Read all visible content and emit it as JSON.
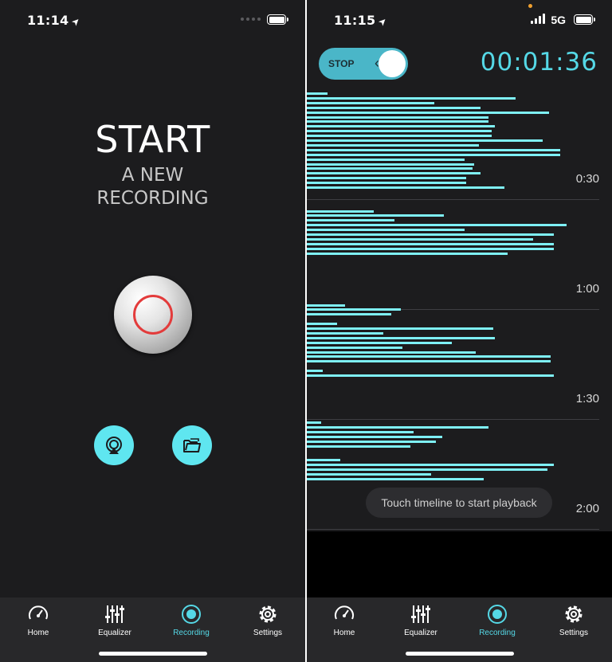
{
  "left_screen": {
    "status": {
      "time": "11:14"
    },
    "title": "START",
    "subtitle_line1": "A NEW",
    "subtitle_line2": "RECORDING",
    "icons": {
      "airplay": "airplay-icon",
      "folder": "folder-icon"
    }
  },
  "right_screen": {
    "status": {
      "time": "11:15",
      "network": "5G"
    },
    "toggle_label": "STOP",
    "timer": "00:01:36",
    "time_markers": [
      "0:30",
      "1:00",
      "1:30",
      "2:00"
    ],
    "toast": "Touch timeline to start playback"
  },
  "tabbar": {
    "tabs": [
      {
        "label": "Home",
        "icon": "speedometer-icon"
      },
      {
        "label": "Equalizer",
        "icon": "equalizer-icon"
      },
      {
        "label": "Recording",
        "icon": "record-icon",
        "active": true
      },
      {
        "label": "Settings",
        "icon": "gear-icon"
      }
    ]
  },
  "colors": {
    "accent": "#55d8e6",
    "bars": "#7ef0f6",
    "record_ring": "#e33b3b",
    "background": "#1c1c1e"
  }
}
